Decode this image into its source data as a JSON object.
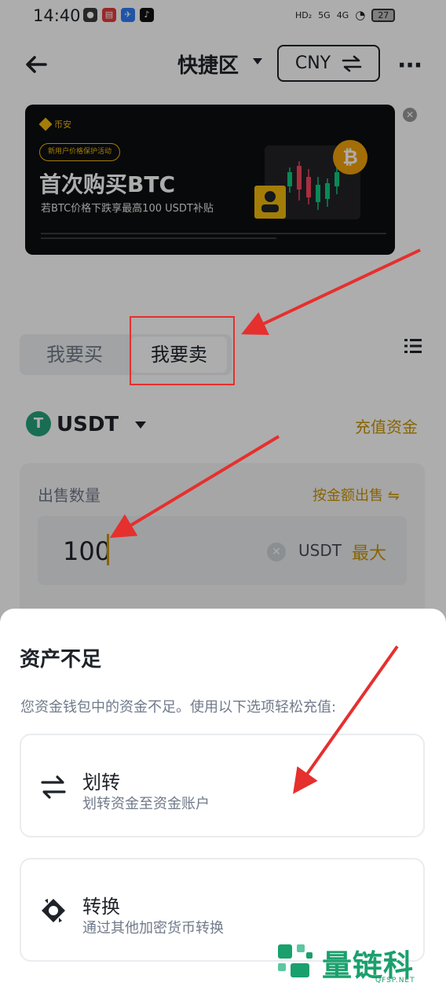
{
  "status_bar": {
    "time": "14:40",
    "network_1": "HD₂",
    "network_2": "5G",
    "network_3": "4G",
    "battery": "27"
  },
  "header": {
    "title": "快捷区",
    "currency": "CNY"
  },
  "banner": {
    "brand": "币安",
    "pill": "新用户价格保护活动",
    "headline": "首次购买BTC",
    "subline": "若BTC价格下跌享最高100 USDT补贴",
    "coin_symbol": "₿"
  },
  "trade_tabs": {
    "buy": "我要买",
    "sell": "我要卖"
  },
  "asset": {
    "name": "USDT",
    "tether_symbol": "T",
    "deposit": "充值资金"
  },
  "sell_form": {
    "label": "出售数量",
    "switch_mode": "按金额出售",
    "amount": "100",
    "unit": "USDT",
    "max": "最大"
  },
  "sheet": {
    "title": "资产不足",
    "description": "您资金钱包中的资金不足。使用以下选项轻松充值:",
    "options": [
      {
        "title": "划转",
        "subtitle": "划转资金至资金账户"
      },
      {
        "title": "转换",
        "subtitle": "通过其他加密货币转换"
      }
    ]
  },
  "watermark": {
    "name": "量链科技",
    "url": "QFSP.NET"
  },
  "colors": {
    "accent": "#c99400",
    "brand_yellow": "#f0b90b",
    "annotation_red": "#e5302e",
    "watermark_green": "#1aa06d"
  }
}
